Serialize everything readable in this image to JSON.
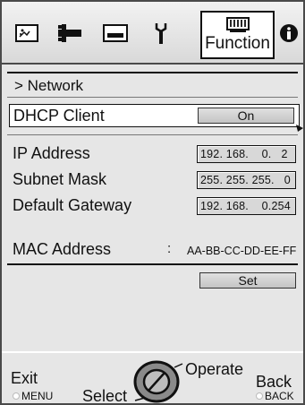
{
  "tabs": {
    "function_label": "Function"
  },
  "network": {
    "header": "> Network",
    "dhcp_label": "DHCP Client",
    "dhcp_value": "On",
    "ip_label": "IP Address",
    "ip_value": "192. 168.    0.   2",
    "subnet_label": "Subnet Mask",
    "subnet_value": "255. 255. 255.   0",
    "gateway_label": "Default Gateway",
    "gateway_value": "192. 168.    0.254",
    "mac_label": "MAC Address",
    "mac_sep": ":",
    "mac_value": "AA-BB-CC-DD-EE-FF",
    "set_label": "Set"
  },
  "footer": {
    "exit": "Exit",
    "menu": "MENU",
    "select": "Select",
    "operate": "Operate",
    "back": "Back",
    "back_key": "BACK"
  }
}
